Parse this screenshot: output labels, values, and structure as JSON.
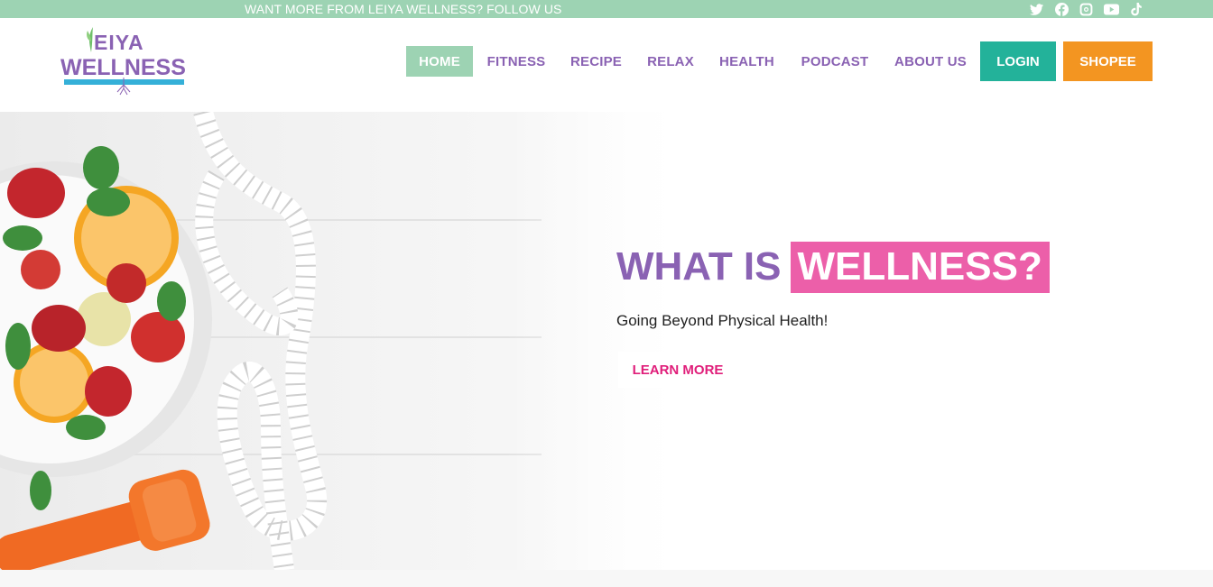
{
  "topbar": {
    "text": "WANT MORE FROM LEIYA WELLNESS? FOLLOW US",
    "social_icons": [
      "twitter-icon",
      "facebook-icon",
      "instagram-icon",
      "youtube-icon",
      "tiktok-icon"
    ]
  },
  "logo": {
    "line1": "EIYA",
    "line2": "WELLNESS"
  },
  "nav": {
    "items": [
      {
        "label": "HOME",
        "active": true
      },
      {
        "label": "FITNESS"
      },
      {
        "label": "RECIPE"
      },
      {
        "label": "RELAX"
      },
      {
        "label": "HEALTH"
      },
      {
        "label": "PODCAST"
      },
      {
        "label": "ABOUT US"
      }
    ],
    "login_label": "LOGIN",
    "shopee_label": "SHOPEE"
  },
  "hero": {
    "title_part1": "WHAT IS",
    "title_part2": "WELLNESS?",
    "subtitle": "Going Beyond Physical Health!",
    "cta_label": "LEARN MORE"
  },
  "colors": {
    "topbar": "#9dd3b3",
    "brand_purple": "#8a62b3",
    "brand_pink": "#ec5fa9",
    "login": "#23b29a",
    "shopee": "#f39521",
    "cta_text": "#e01e7a"
  }
}
